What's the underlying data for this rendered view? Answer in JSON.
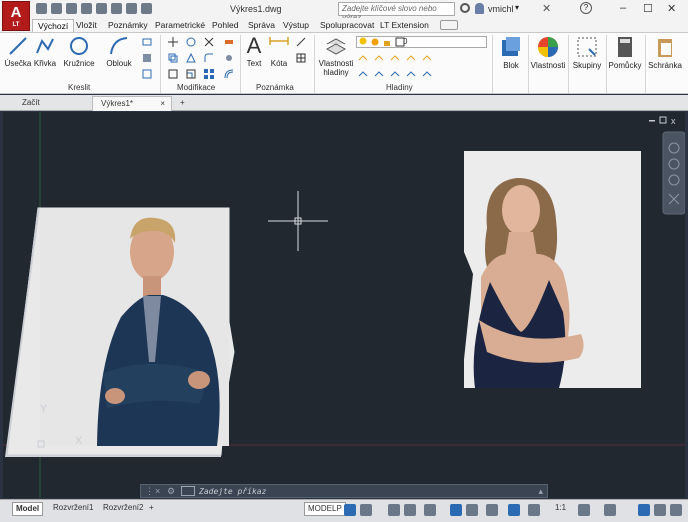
{
  "app": {
    "logo": "A",
    "logo_sub": "LT",
    "document_title": "Výkres1.dwg"
  },
  "search": {
    "placeholder": "Zadejte klíčové slovo nebo výraz."
  },
  "user": {
    "name": "vmichl"
  },
  "ribbon_tabs": [
    "Výchozí",
    "Vložit",
    "Poznámky",
    "Parametrické",
    "Pohled",
    "Správa",
    "Výstup",
    "Spolupracovat",
    "LT Extension"
  ],
  "ribbon": {
    "kreslit": {
      "label": "Kreslit",
      "buttons": [
        "Úsečka",
        "Křivka",
        "Kružnice",
        "Oblouk"
      ]
    },
    "modifikace": {
      "label": "Modifikace"
    },
    "poznamka": {
      "label": "Poznámka",
      "buttons": [
        "Text",
        "Kóta"
      ]
    },
    "hladiny": {
      "label": "Hladiny",
      "button": "Vlastnosti hladiny",
      "current_layer": "0"
    },
    "blok": "Blok",
    "vlastnosti": "Vlastnosti",
    "skupiny": "Skupiny",
    "pomucky": "Pomůcky",
    "schranka": "Schránka"
  },
  "file_tabs": [
    "Začít",
    "Výkres1*"
  ],
  "command": {
    "placeholder": "Zadejte příkaz"
  },
  "status": {
    "layout_tabs": [
      "Model",
      "Rozvržení1",
      "Rozvržení2"
    ],
    "space": "MODELP",
    "scale": "1:1"
  },
  "colors": {
    "drawing_bg": "#212830",
    "accent": "#2c6bb3",
    "logo_red": "#b31b1b"
  }
}
